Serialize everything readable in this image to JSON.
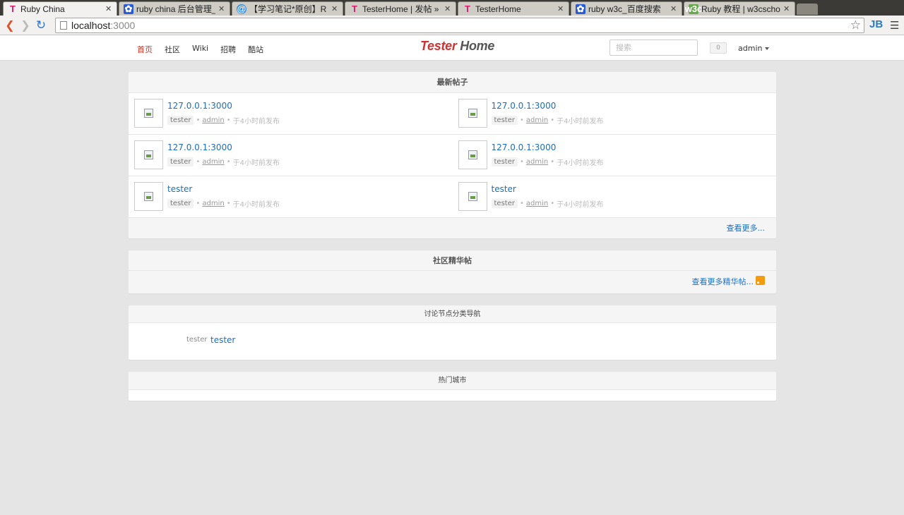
{
  "browser": {
    "tabs": [
      {
        "title": "Ruby China",
        "icon": "t-logo-icon"
      },
      {
        "title": "ruby china 后台管理_",
        "icon": "baidu-paw-icon"
      },
      {
        "title": "【学习笔记*原创】R",
        "icon": "circle-icon"
      },
      {
        "title": "TesterHome | 发帖 »",
        "icon": "t-logo-icon"
      },
      {
        "title": "TesterHome",
        "icon": "t-logo-icon"
      },
      {
        "title": "ruby w3c_百度搜索",
        "icon": "baidu-paw-icon"
      },
      {
        "title": "Ruby 教程 | w3cscho",
        "icon": "w3c-icon"
      }
    ],
    "url_host": "localhost",
    "url_port": ":3000",
    "jb_label": "JB"
  },
  "nav": {
    "links": [
      "首页",
      "社区",
      "Wiki",
      "招聘",
      "酷站"
    ],
    "logo_part1": "Tester",
    "logo_part2": "Home",
    "search_placeholder": "搜索",
    "notification_count": "0",
    "user": "admin"
  },
  "latest": {
    "title": "最新帖子",
    "topics": [
      {
        "title": "127.0.0.1:3000",
        "node": "tester",
        "author": "admin",
        "time": "于4小时前发布"
      },
      {
        "title": "127.0.0.1:3000",
        "node": "tester",
        "author": "admin",
        "time": "于4小时前发布"
      },
      {
        "title": "127.0.0.1:3000",
        "node": "tester",
        "author": "admin",
        "time": "于4小时前发布"
      },
      {
        "title": "127.0.0.1:3000",
        "node": "tester",
        "author": "admin",
        "time": "于4小时前发布"
      },
      {
        "title": "tester",
        "node": "tester",
        "author": "admin",
        "time": "于4小时前发布"
      },
      {
        "title": "tester",
        "node": "tester",
        "author": "admin",
        "time": "于4小时前发布"
      }
    ],
    "more": "查看更多..."
  },
  "excellent": {
    "title": "社区精华帖",
    "more": "查看更多精华帖..."
  },
  "nodes": {
    "title": "讨论节点分类导航",
    "section": "tester",
    "link": "tester"
  },
  "cities": {
    "title": "热门城市"
  },
  "colors": {
    "accent_link": "#1a6fc2",
    "active_nav": "#c0392b",
    "logo_red": "#cc3333",
    "page_bg": "#e5e5e5"
  }
}
